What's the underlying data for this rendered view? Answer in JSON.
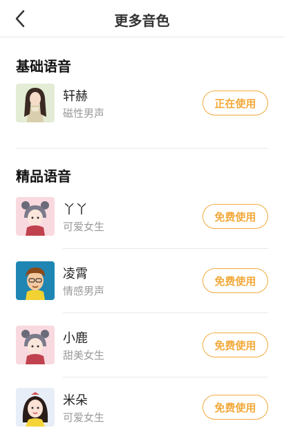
{
  "header": {
    "title": "更多音色"
  },
  "sections": [
    {
      "title": "基础语音",
      "items": [
        {
          "name": "轩赫",
          "desc": "磁性男声",
          "action": "正在使用"
        }
      ]
    },
    {
      "title": "精品语音",
      "items": [
        {
          "name": "丫丫",
          "desc": "可爱女生",
          "action": "免费使用"
        },
        {
          "name": "凌霄",
          "desc": "情感男声",
          "action": "免费使用"
        },
        {
          "name": "小鹿",
          "desc": "甜美女生",
          "action": "免费使用"
        },
        {
          "name": "米朵",
          "desc": "可爱女生",
          "action": "免费使用"
        }
      ]
    }
  ],
  "colors": {
    "accent": "#f2a93b",
    "subtext": "#9a9a9a"
  }
}
